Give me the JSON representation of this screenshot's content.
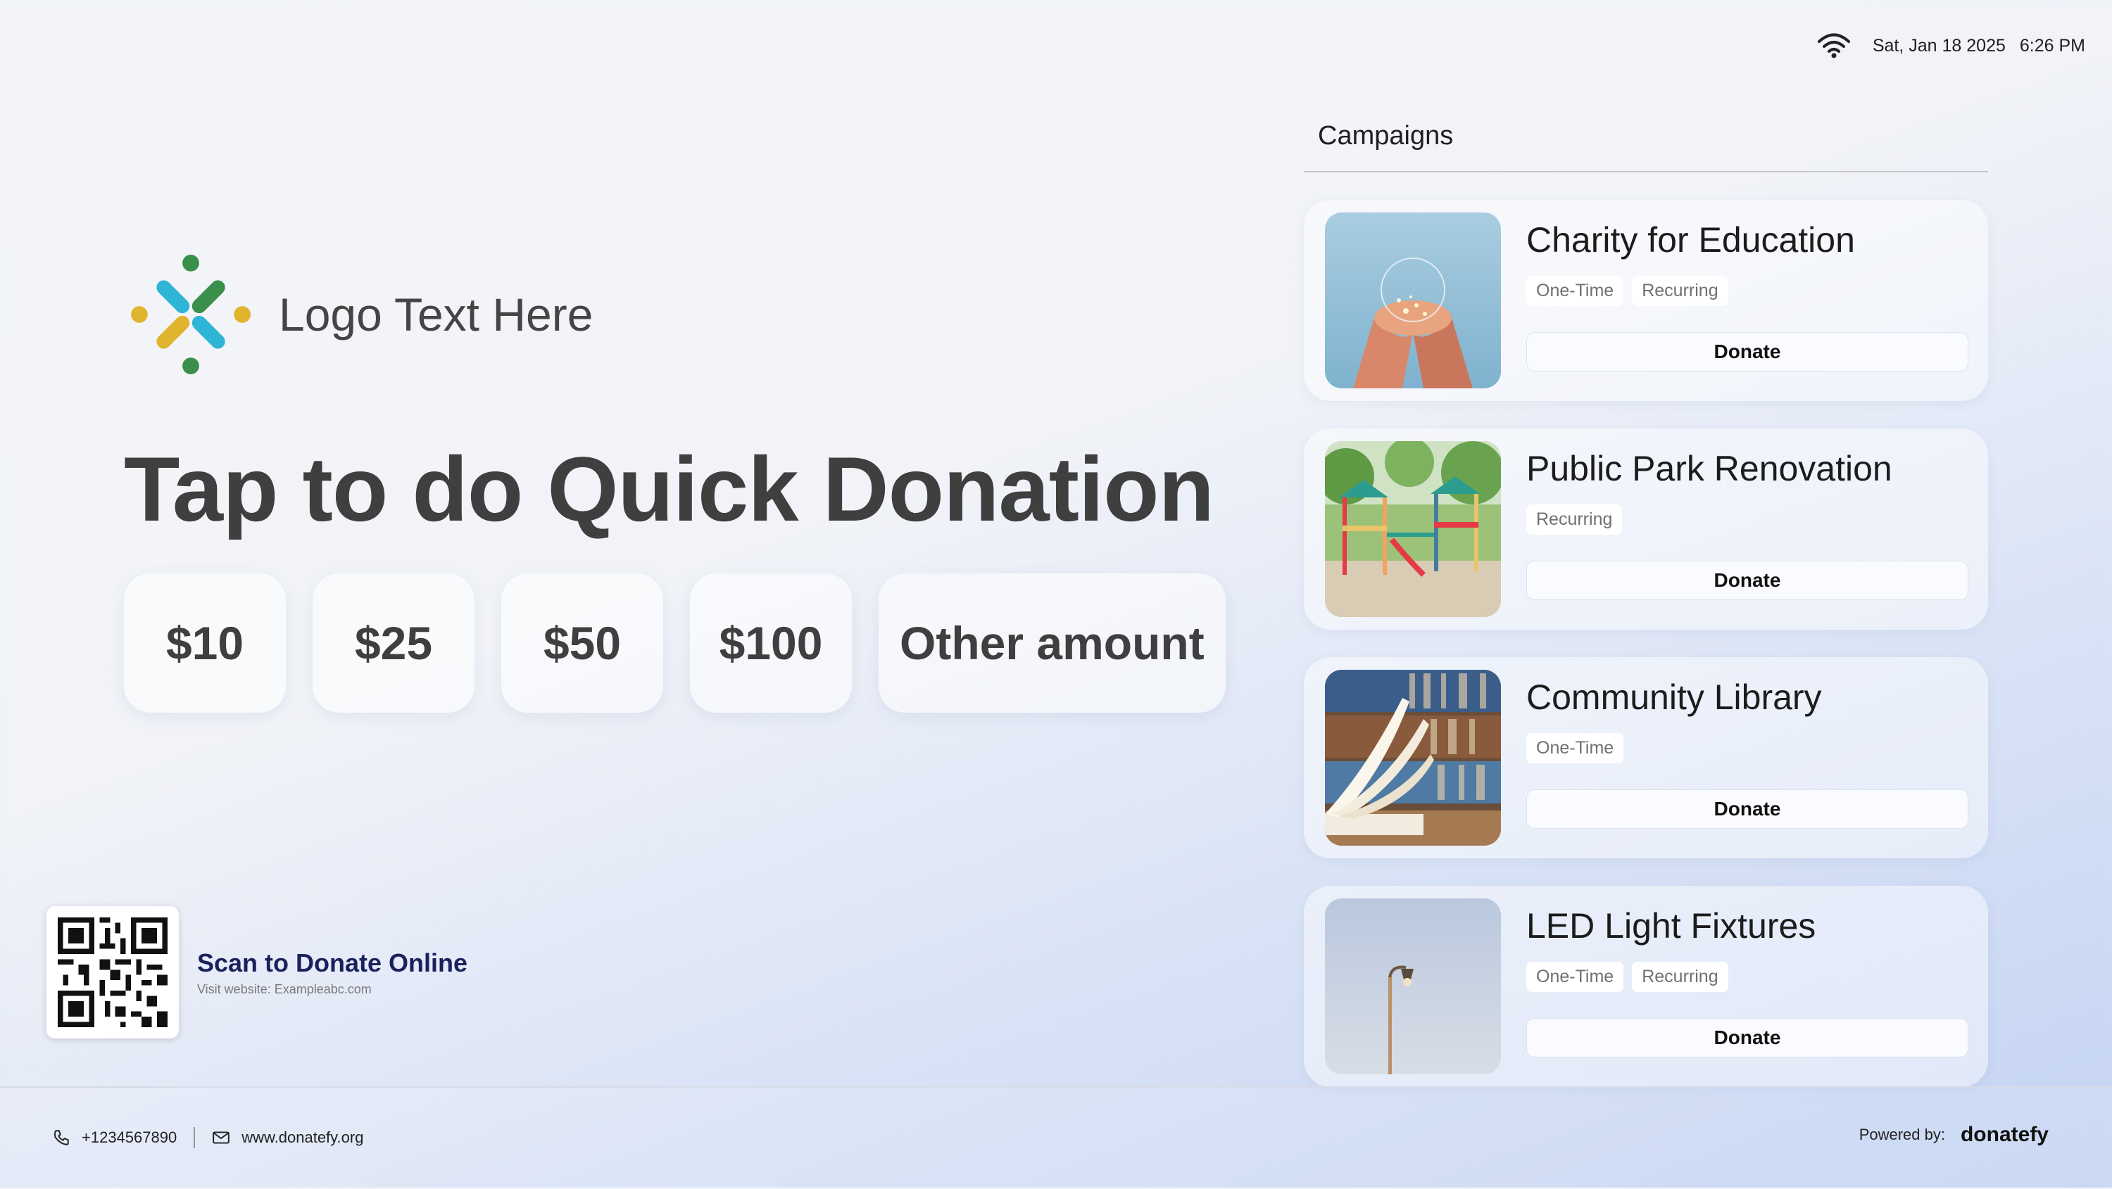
{
  "status": {
    "wifi_icon": "wifi-icon",
    "date": "Sat, Jan 18 2025",
    "time": "6:26 PM"
  },
  "logo": {
    "text": "Logo Text Here",
    "icon": "people-circle-logo",
    "colors": [
      "#2fb5d6",
      "#3a8f4a",
      "#e0b52d"
    ]
  },
  "headline": "Tap to do Quick Donation",
  "amounts": [
    "$10",
    "$25",
    "$50",
    "$100",
    "Other amount"
  ],
  "qr": {
    "title": "Scan to Donate Online",
    "subtitle": "Visit website: Exampleabc.com"
  },
  "campaigns": {
    "title": "Campaigns",
    "items": [
      {
        "title": "Charity for Education",
        "tags": [
          "One-Time",
          "Recurring"
        ],
        "button": "Donate",
        "image": "hands-light-photo"
      },
      {
        "title": "Public Park Renovation",
        "tags": [
          "Recurring"
        ],
        "button": "Donate",
        "image": "playground-photo"
      },
      {
        "title": "Community Library",
        "tags": [
          "One-Time"
        ],
        "button": "Donate",
        "image": "open-book-photo"
      },
      {
        "title": "LED Light Fixtures",
        "tags": [
          "One-Time",
          "Recurring"
        ],
        "button": "Donate",
        "image": "street-lamp-photo"
      }
    ]
  },
  "footer": {
    "phone": "+1234567890",
    "website": "www.donatefy.org",
    "powered_by": "Powered by:",
    "brand": "donatefy"
  }
}
